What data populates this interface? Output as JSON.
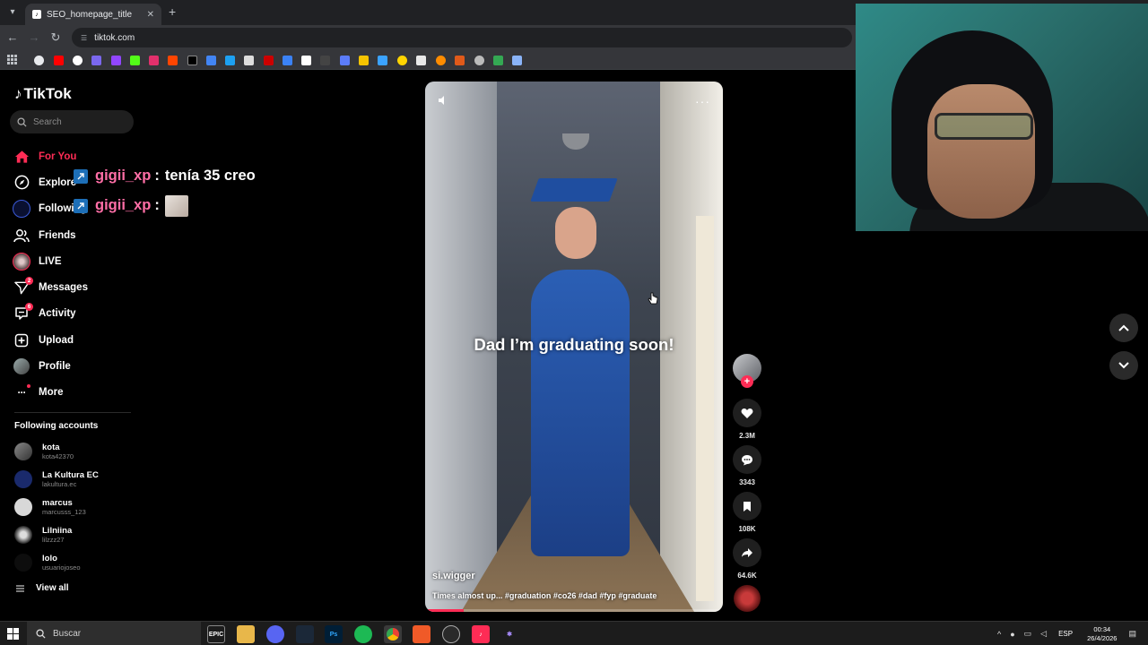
{
  "browser": {
    "tab_title": "SEO_homepage_title",
    "url": "tiktok.com"
  },
  "app": {
    "logo_text": "TikTok",
    "search_placeholder": "Search"
  },
  "nav": [
    {
      "label": "For You",
      "icon": "home-icon",
      "active": true
    },
    {
      "label": "Explore",
      "icon": "compass-icon"
    },
    {
      "label": "Following",
      "icon": "following-avatar-icon"
    },
    {
      "label": "Friends",
      "icon": "friends-icon"
    },
    {
      "label": "LIVE",
      "icon": "live-avatar-icon"
    },
    {
      "label": "Messages",
      "icon": "messages-icon",
      "badge": "2"
    },
    {
      "label": "Activity",
      "icon": "activity-icon",
      "badge": "6"
    },
    {
      "label": "Upload",
      "icon": "upload-icon"
    },
    {
      "label": "Profile",
      "icon": "profile-avatar-icon"
    },
    {
      "label": "More",
      "icon": "more-dots-icon"
    }
  ],
  "following_accounts": {
    "title": "Following accounts",
    "items": [
      {
        "name": "kota",
        "username": "kota42370"
      },
      {
        "name": "La Kultura EC",
        "username": "lakultura.ec"
      },
      {
        "name": "marcus",
        "username": "marcusss_123"
      },
      {
        "name": "Lilniina",
        "username": "lilzzz27"
      },
      {
        "name": "lolo",
        "username": "usuariojoseo"
      }
    ],
    "view_all": "View all"
  },
  "chat": [
    {
      "user": "gigii_xp",
      "message": "tenía 35 creo"
    },
    {
      "user": "gigii_xp",
      "message": ""
    }
  ],
  "video": {
    "caption": "Dad I’m graduating soon!",
    "author": "si.wigger",
    "description": "Times almost up... #graduation #co26 #dad #fyp #graduate",
    "progress": 0.13
  },
  "actions": {
    "likes": "2.3M",
    "comments": "3343",
    "saves": "108K",
    "shares": "64.6K"
  },
  "taskbar": {
    "search_placeholder": "Buscar",
    "language": "ESP",
    "time": "00:34",
    "date": "26/4/2026"
  },
  "colors": {
    "accent": "#fe2c55",
    "chat_user": "#ff6ea6"
  }
}
